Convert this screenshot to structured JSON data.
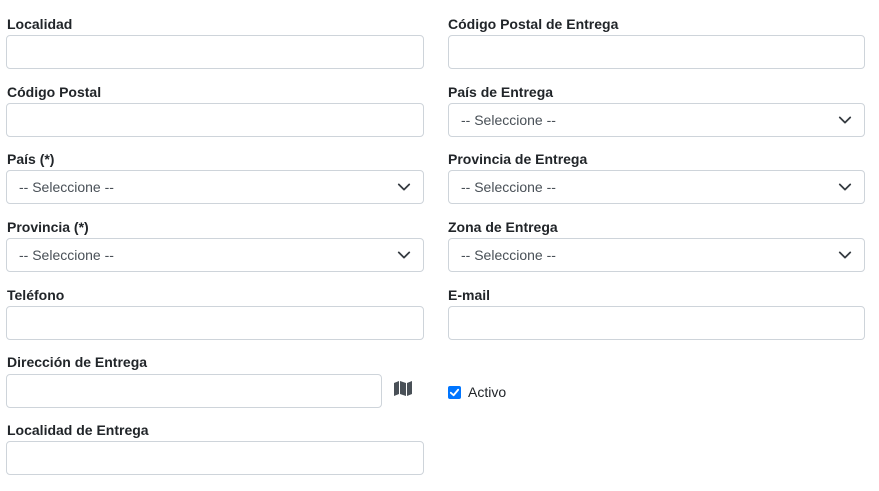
{
  "fields": {
    "localidad": {
      "label": "Localidad",
      "value": "",
      "placeholder": ""
    },
    "codigo_postal_entrega": {
      "label": "Código Postal de Entrega",
      "value": "",
      "placeholder": ""
    },
    "codigo_postal": {
      "label": "Código Postal",
      "value": "",
      "placeholder": ""
    },
    "pais_entrega": {
      "label": "País de Entrega",
      "selected": "-- Seleccione --"
    },
    "pais": {
      "label": "País (*)",
      "selected": "-- Seleccione --"
    },
    "provincia_entrega": {
      "label": "Provincia de Entrega",
      "selected": "-- Seleccione --"
    },
    "provincia": {
      "label": "Provincia (*)",
      "selected": "-- Seleccione --"
    },
    "zona_entrega": {
      "label": "Zona de Entrega",
      "selected": "-- Seleccione --"
    },
    "telefono": {
      "label": "Teléfono",
      "value": "",
      "placeholder": ""
    },
    "email": {
      "label": "E-mail",
      "value": "",
      "placeholder": ""
    },
    "direccion_entrega": {
      "label": "Dirección de Entrega",
      "value": "",
      "placeholder": "",
      "icon": "map-icon"
    },
    "localidad_entrega": {
      "label": "Localidad de Entrega",
      "value": "",
      "placeholder": ""
    },
    "activo": {
      "label": "Activo",
      "checked": true
    }
  },
  "colors": {
    "checkbox": "#0075ff",
    "border": "#ced4da",
    "text": "#212529"
  }
}
